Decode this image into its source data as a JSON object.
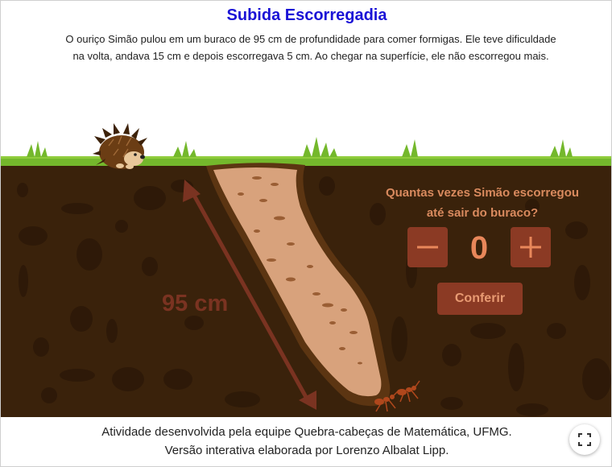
{
  "game": {
    "title": "Subida Escorregadia",
    "description_line1": "O ouriço Simão pulou em um buraco de 95 cm de profundidade para comer formigas. Ele teve dificuldade",
    "description_line2": "na volta, andava 15 cm e depois escorregava 5 cm. Ao chegar na superfície, ele não escorregou mais.",
    "depth_label": "95 cm",
    "question_line1": "Quantas vezes Simão escorregou",
    "question_line2": "até sair do buraco?",
    "counter_value": "0",
    "minus_label": "−",
    "plus_label": "+",
    "check_button": "Conferir"
  },
  "footer": {
    "credit_line1": "Atividade desenvolvida pela equipe Quebra-cabeças de Matemática, UFMG.",
    "credit_line2": "Versão interativa elaborada por Lorenzo Albalat Lipp."
  },
  "icons": {
    "fullscreen": "fullscreen-icon",
    "hedgehog": "hedgehog-icon",
    "ants": "ant-icon"
  },
  "colors": {
    "title": "#1a12d6",
    "soil": "#3a220b",
    "grass": "#74b82c",
    "hole": "#d8a27c",
    "buttons": "#8b3a24",
    "accent": "#e8875a"
  }
}
